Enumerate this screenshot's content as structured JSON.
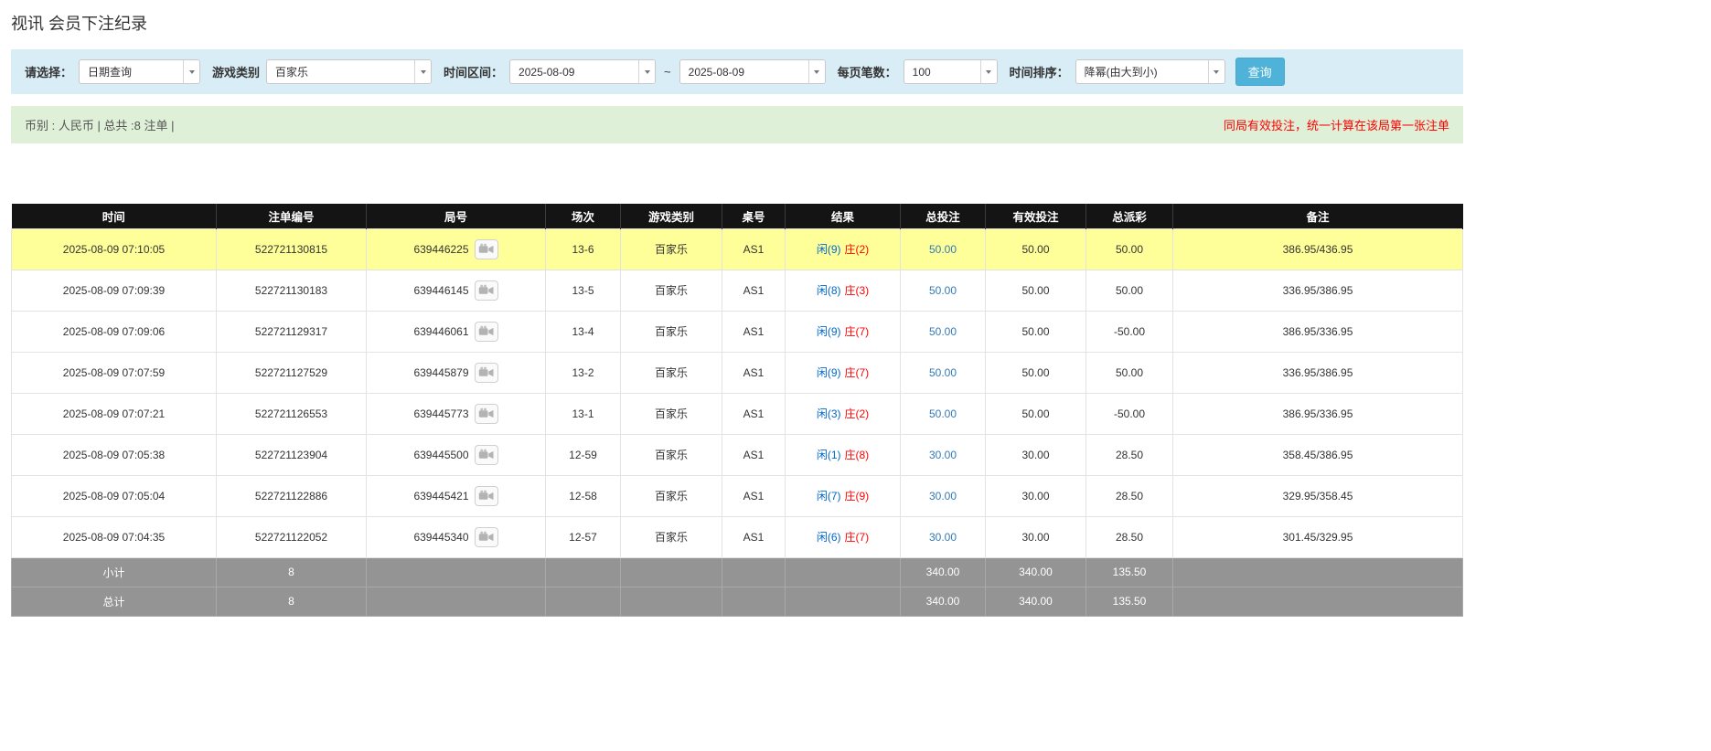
{
  "page": {
    "title": "视讯 会员下注纪录"
  },
  "filters": {
    "select_label": "请选择：",
    "select_value": "日期查询",
    "game_type_label": "游戏类别",
    "game_type_value": "百家乐",
    "time_range_label": "时间区间：",
    "date_from": "2025-08-09",
    "date_tilde": "~",
    "date_to": "2025-08-09",
    "per_page_label": "每页笔数：",
    "per_page_value": "100",
    "sort_label": "时间排序：",
    "sort_value": "降幂(由大到小)",
    "search_button": "查询"
  },
  "summary": {
    "left": "币别 : 人民币 | 总共 :8 注单 |",
    "right": "同局有效投注，统一计算在该局第一张注单"
  },
  "table": {
    "headers": [
      "时间",
      "注单编号",
      "局号",
      "场次",
      "游戏类别",
      "桌号",
      "结果",
      "总投注",
      "有效投注",
      "总派彩",
      "备注"
    ],
    "rows": [
      {
        "time": "2025-08-09 07:10:05",
        "bet_id": "522721130815",
        "round": "639446225",
        "session": "13-6",
        "game": "百家乐",
        "table_no": "AS1",
        "result_player": "闲(9)",
        "result_banker": "庄(2)",
        "total_bet": "50.00",
        "valid_bet": "50.00",
        "payout": "50.00",
        "remark": "386.95/436.95",
        "highlight": true
      },
      {
        "time": "2025-08-09 07:09:39",
        "bet_id": "522721130183",
        "round": "639446145",
        "session": "13-5",
        "game": "百家乐",
        "table_no": "AS1",
        "result_player": "闲(8)",
        "result_banker": "庄(3)",
        "total_bet": "50.00",
        "valid_bet": "50.00",
        "payout": "50.00",
        "remark": "336.95/386.95",
        "highlight": false
      },
      {
        "time": "2025-08-09 07:09:06",
        "bet_id": "522721129317",
        "round": "639446061",
        "session": "13-4",
        "game": "百家乐",
        "table_no": "AS1",
        "result_player": "闲(9)",
        "result_banker": "庄(7)",
        "total_bet": "50.00",
        "valid_bet": "50.00",
        "payout": "-50.00",
        "remark": "386.95/336.95",
        "highlight": false
      },
      {
        "time": "2025-08-09 07:07:59",
        "bet_id": "522721127529",
        "round": "639445879",
        "session": "13-2",
        "game": "百家乐",
        "table_no": "AS1",
        "result_player": "闲(9)",
        "result_banker": "庄(7)",
        "total_bet": "50.00",
        "valid_bet": "50.00",
        "payout": "50.00",
        "remark": "336.95/386.95",
        "highlight": false
      },
      {
        "time": "2025-08-09 07:07:21",
        "bet_id": "522721126553",
        "round": "639445773",
        "session": "13-1",
        "game": "百家乐",
        "table_no": "AS1",
        "result_player": "闲(3)",
        "result_banker": "庄(2)",
        "total_bet": "50.00",
        "valid_bet": "50.00",
        "payout": "-50.00",
        "remark": "386.95/336.95",
        "highlight": false
      },
      {
        "time": "2025-08-09 07:05:38",
        "bet_id": "522721123904",
        "round": "639445500",
        "session": "12-59",
        "game": "百家乐",
        "table_no": "AS1",
        "result_player": "闲(1)",
        "result_banker": "庄(8)",
        "total_bet": "30.00",
        "valid_bet": "30.00",
        "payout": "28.50",
        "remark": "358.45/386.95",
        "highlight": false
      },
      {
        "time": "2025-08-09 07:05:04",
        "bet_id": "522721122886",
        "round": "639445421",
        "session": "12-58",
        "game": "百家乐",
        "table_no": "AS1",
        "result_player": "闲(7)",
        "result_banker": "庄(9)",
        "total_bet": "30.00",
        "valid_bet": "30.00",
        "payout": "28.50",
        "remark": "329.95/358.45",
        "highlight": false
      },
      {
        "time": "2025-08-09 07:04:35",
        "bet_id": "522721122052",
        "round": "639445340",
        "session": "12-57",
        "game": "百家乐",
        "table_no": "AS1",
        "result_player": "闲(6)",
        "result_banker": "庄(7)",
        "total_bet": "30.00",
        "valid_bet": "30.00",
        "payout": "28.50",
        "remark": "301.45/329.95",
        "highlight": false
      }
    ],
    "subtotal": {
      "label": "小计",
      "count": "8",
      "total_bet": "340.00",
      "valid_bet": "340.00",
      "payout": "135.50"
    },
    "total": {
      "label": "总计",
      "count": "8",
      "total_bet": "340.00",
      "valid_bet": "340.00",
      "payout": "135.50"
    }
  }
}
